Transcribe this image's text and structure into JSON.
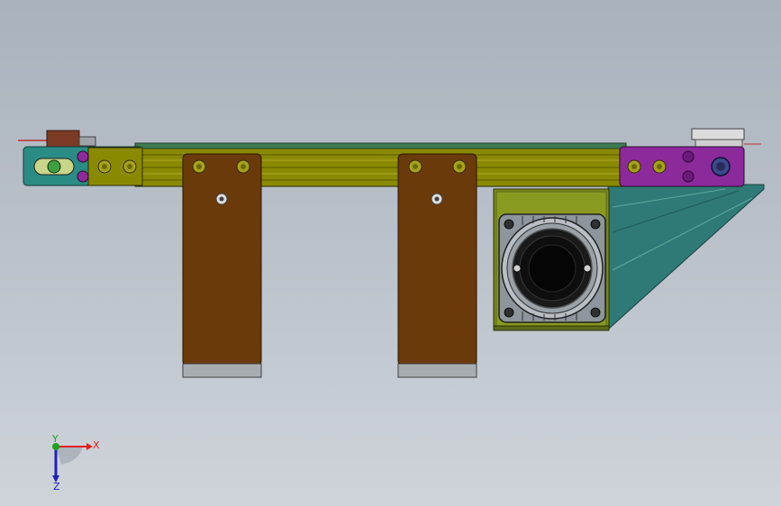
{
  "triad": {
    "x_label": "X",
    "y_label": "Y",
    "z_label": "Z"
  },
  "colors": {
    "background_top": "#a9b2bd",
    "background_bottom": "#cfd4da",
    "rail": "#8a8a00",
    "rail_light": "#a8a21a",
    "bracket_left": "#2a8c84",
    "end_plate_right": "#8c2a9c",
    "legs": "#6b3a0a",
    "motor_mount": "#7d8a1e",
    "motor_body": "#8e959c",
    "support_triangle": "#2f7a76",
    "axis_x": "#e02020",
    "axis_y": "#20a020",
    "axis_z": "#2020c0"
  }
}
